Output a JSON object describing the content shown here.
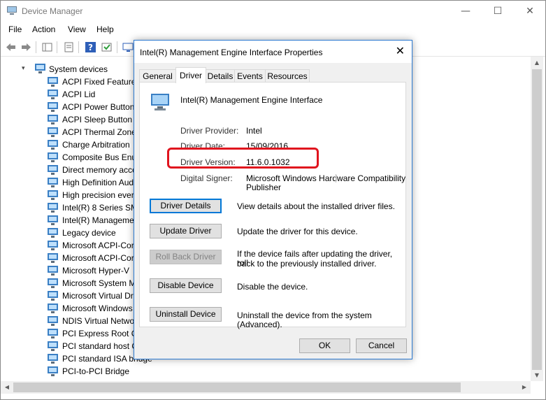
{
  "window": {
    "title": "Device Manager",
    "minimize": "—",
    "maximize": "☐",
    "close": "✕"
  },
  "menu": [
    "File",
    "Action",
    "View",
    "Help"
  ],
  "tree": {
    "root": "System devices",
    "items": [
      "ACPI Fixed Feature",
      "ACPI Lid",
      "ACPI Power Button",
      "ACPI Sleep Button",
      "ACPI Thermal Zone",
      "Charge Arbitration",
      "Composite Bus Enu",
      "Direct memory acce",
      "High Definition Aud",
      "High precision ever",
      "Intel(R) 8 Series SM",
      "Intel(R) Manageme",
      "Legacy device",
      "Microsoft ACPI-Cor",
      "Microsoft ACPI-Cor",
      "Microsoft Hyper-V",
      "Microsoft System M",
      "Microsoft Virtual Dr",
      "Microsoft Windows",
      "NDIS Virtual Netwo",
      "PCI Express Root Co",
      "PCI standard host C",
      "PCI standard ISA bridge",
      "PCI-to-PCI Bridge"
    ]
  },
  "dialog": {
    "title": "Intel(R) Management Engine Interface  Properties",
    "close": "✕",
    "tabs": [
      "General",
      "Driver",
      "Details",
      "Events",
      "Resources"
    ],
    "active_tab": "Driver",
    "device_name": "Intel(R) Management Engine Interface",
    "props": {
      "provider_label": "Driver Provider:",
      "provider": "Intel",
      "date_label": "Driver Date:",
      "date": "15/09/2016",
      "version_label": "Driver Version:",
      "version": "11.6.0.1032",
      "signer_label": "Digital Signer:",
      "signer_line1": "Microsoft Windows Hardware Compatibility",
      "signer_line2": "Publisher"
    },
    "buttons": {
      "details": "Driver Details",
      "details_desc": "View details about the installed driver files.",
      "update": "Update Driver",
      "update_desc": "Update the driver for this device.",
      "rollback": "Roll Back Driver",
      "rollback_desc1": "If the device fails after updating the driver, roll",
      "rollback_desc2": "back to the previously installed driver.",
      "disable": "Disable Device",
      "disable_desc": "Disable the device.",
      "uninstall": "Uninstall Device",
      "uninstall_desc": "Uninstall the device from the system (Advanced).",
      "ok": "OK",
      "cancel": "Cancel"
    }
  },
  "colors": {
    "highlight": "#e0141e",
    "accent": "#0078d7"
  }
}
